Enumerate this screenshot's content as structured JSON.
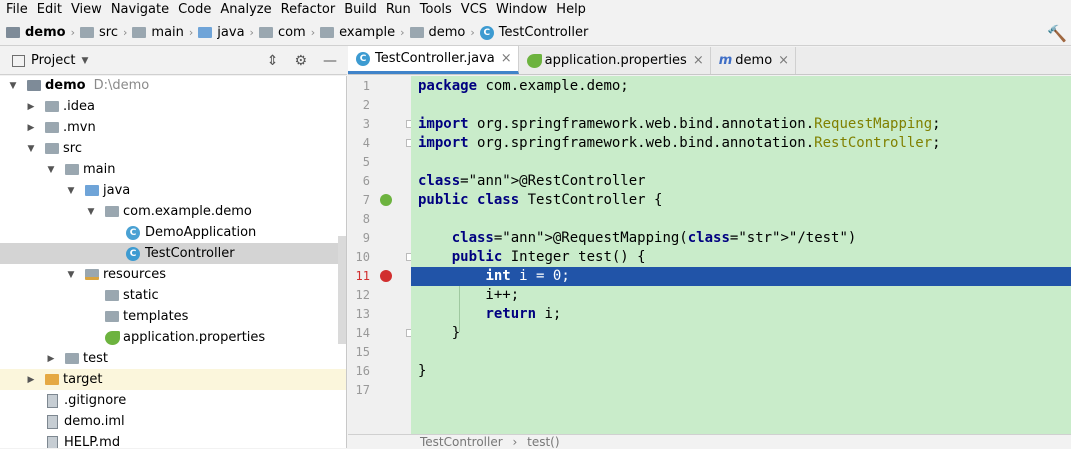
{
  "menu": [
    "File",
    "Edit",
    "View",
    "Navigate",
    "Code",
    "Analyze",
    "Refactor",
    "Build",
    "Run",
    "Tools",
    "VCS",
    "Window",
    "Help"
  ],
  "breadcrumbs": [
    "demo",
    "src",
    "main",
    "java",
    "com",
    "example",
    "demo",
    "TestController"
  ],
  "project_panel": {
    "title": "Project",
    "tree": [
      {
        "label": "demo",
        "extra": "D:\\demo",
        "icon": "module-folder-icon",
        "expanded": true
      },
      {
        "label": ".idea",
        "icon": "folder-icon",
        "expanded": false
      },
      {
        "label": ".mvn",
        "icon": "folder-icon",
        "expanded": false
      },
      {
        "label": "src",
        "icon": "folder-icon",
        "expanded": true
      },
      {
        "label": "main",
        "icon": "folder-icon",
        "expanded": true
      },
      {
        "label": "java",
        "icon": "source-folder-icon",
        "expanded": true
      },
      {
        "label": "com.example.demo",
        "icon": "package-icon",
        "expanded": true
      },
      {
        "label": "DemoApplication",
        "icon": "spring-class-icon"
      },
      {
        "label": "TestController",
        "icon": "class-icon",
        "selected": true
      },
      {
        "label": "resources",
        "icon": "resources-folder-icon",
        "expanded": true
      },
      {
        "label": "static",
        "icon": "folder-icon"
      },
      {
        "label": "templates",
        "icon": "folder-icon"
      },
      {
        "label": "application.properties",
        "icon": "spring-properties-icon"
      },
      {
        "label": "test",
        "icon": "folder-icon",
        "expanded": false
      },
      {
        "label": "target",
        "icon": "excluded-folder-icon",
        "expanded": false
      },
      {
        "label": ".gitignore",
        "icon": "file-icon"
      },
      {
        "label": "demo.iml",
        "icon": "file-icon"
      },
      {
        "label": "HELP.md",
        "icon": "file-icon"
      }
    ]
  },
  "tabs": [
    {
      "label": "TestController.java",
      "icon": "class-icon",
      "active": true
    },
    {
      "label": "application.properties",
      "icon": "spring-properties-icon"
    },
    {
      "label": "demo",
      "icon": "maven-icon"
    }
  ],
  "code": {
    "line_numbers": [
      "1",
      "2",
      "3",
      "4",
      "5",
      "6",
      "7",
      "8",
      "9",
      "10",
      "11",
      "12",
      "13",
      "14",
      "15",
      "16",
      "17"
    ],
    "current_line": 11,
    "lines": [
      "package com.example.demo;",
      "",
      "import org.springframework.web.bind.annotation.RequestMapping;",
      "import org.springframework.web.bind.annotation.RestController;",
      "",
      "@RestController",
      "public class TestController {",
      "",
      "    @RequestMapping(\"/test\")",
      "    public Integer test() {",
      "        int i = 0;",
      "        i++;",
      "        return i;",
      "    }",
      "",
      "}",
      ""
    ]
  },
  "editor_breadcrumb": [
    "TestController",
    "test()"
  ],
  "colors": {
    "editor_bg": "#c9ecca",
    "current_line": "#2154a8",
    "breakpoint": "#d12f2f"
  }
}
